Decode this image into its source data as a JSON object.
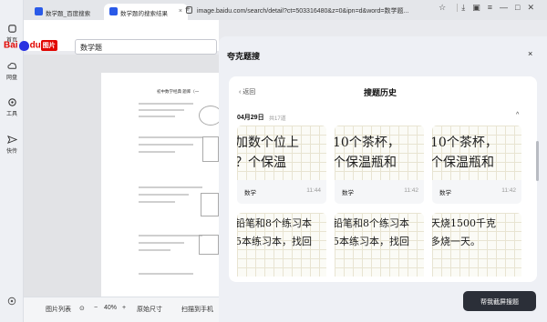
{
  "sidebar": {
    "items": [
      {
        "label": "首页",
        "icon": "home-icon"
      },
      {
        "label": "网盘",
        "icon": "cloud-icon"
      },
      {
        "label": "工具",
        "icon": "tool-icon"
      },
      {
        "label": "快传",
        "icon": "send-icon"
      }
    ]
  },
  "tabs": [
    {
      "label": "数学题_百度搜索",
      "active": false
    },
    {
      "label": "数学题的搜索结果",
      "active": true
    }
  ],
  "address_bar": {
    "url": "image.baidu.com/search/detail?ct=503316480&z=0&ipn=d&word=数学题..."
  },
  "baidu": {
    "logo_text": "Bai",
    "logo_text2": "du",
    "logo_badge": "图片",
    "search_value": "数学题"
  },
  "document": {
    "title": "初中数学经典  题库（一"
  },
  "bottom_toolbar": {
    "list_label": "图片列表",
    "zoom_minus": "−",
    "zoom_value": "40%",
    "zoom_plus": "+",
    "original_size": "原始尺寸",
    "scan_to_phone": "扫描到手机"
  },
  "panel": {
    "title": "夸克题搜",
    "close": "×",
    "back_label": "返回",
    "history_title": "搜题历史",
    "date": "04月29日",
    "count": "共17道",
    "collapse": "^",
    "items": [
      {
        "lines": [
          "加数个位上",
          "？个保温"
        ],
        "subject": "数学",
        "time": "11:44"
      },
      {
        "lines": [
          "10个茶杯，",
          "个保温瓶和"
        ],
        "subject": "数学",
        "time": "11:42"
      },
      {
        "lines": [
          "10个茶杯，",
          "个保温瓶和"
        ],
        "subject": "数学",
        "time": "11:42"
      }
    ],
    "items_row2": [
      {
        "lines": [
          "铅笔和8个练习本",
          "5本练习本，找回"
        ]
      },
      {
        "lines": [
          "铅笔和8个练习本",
          "5本练习本，找回"
        ]
      },
      {
        "lines": [
          "天烧1500千克",
          "多烧一天。"
        ]
      }
    ],
    "cta": "帮我截屏搜题"
  }
}
